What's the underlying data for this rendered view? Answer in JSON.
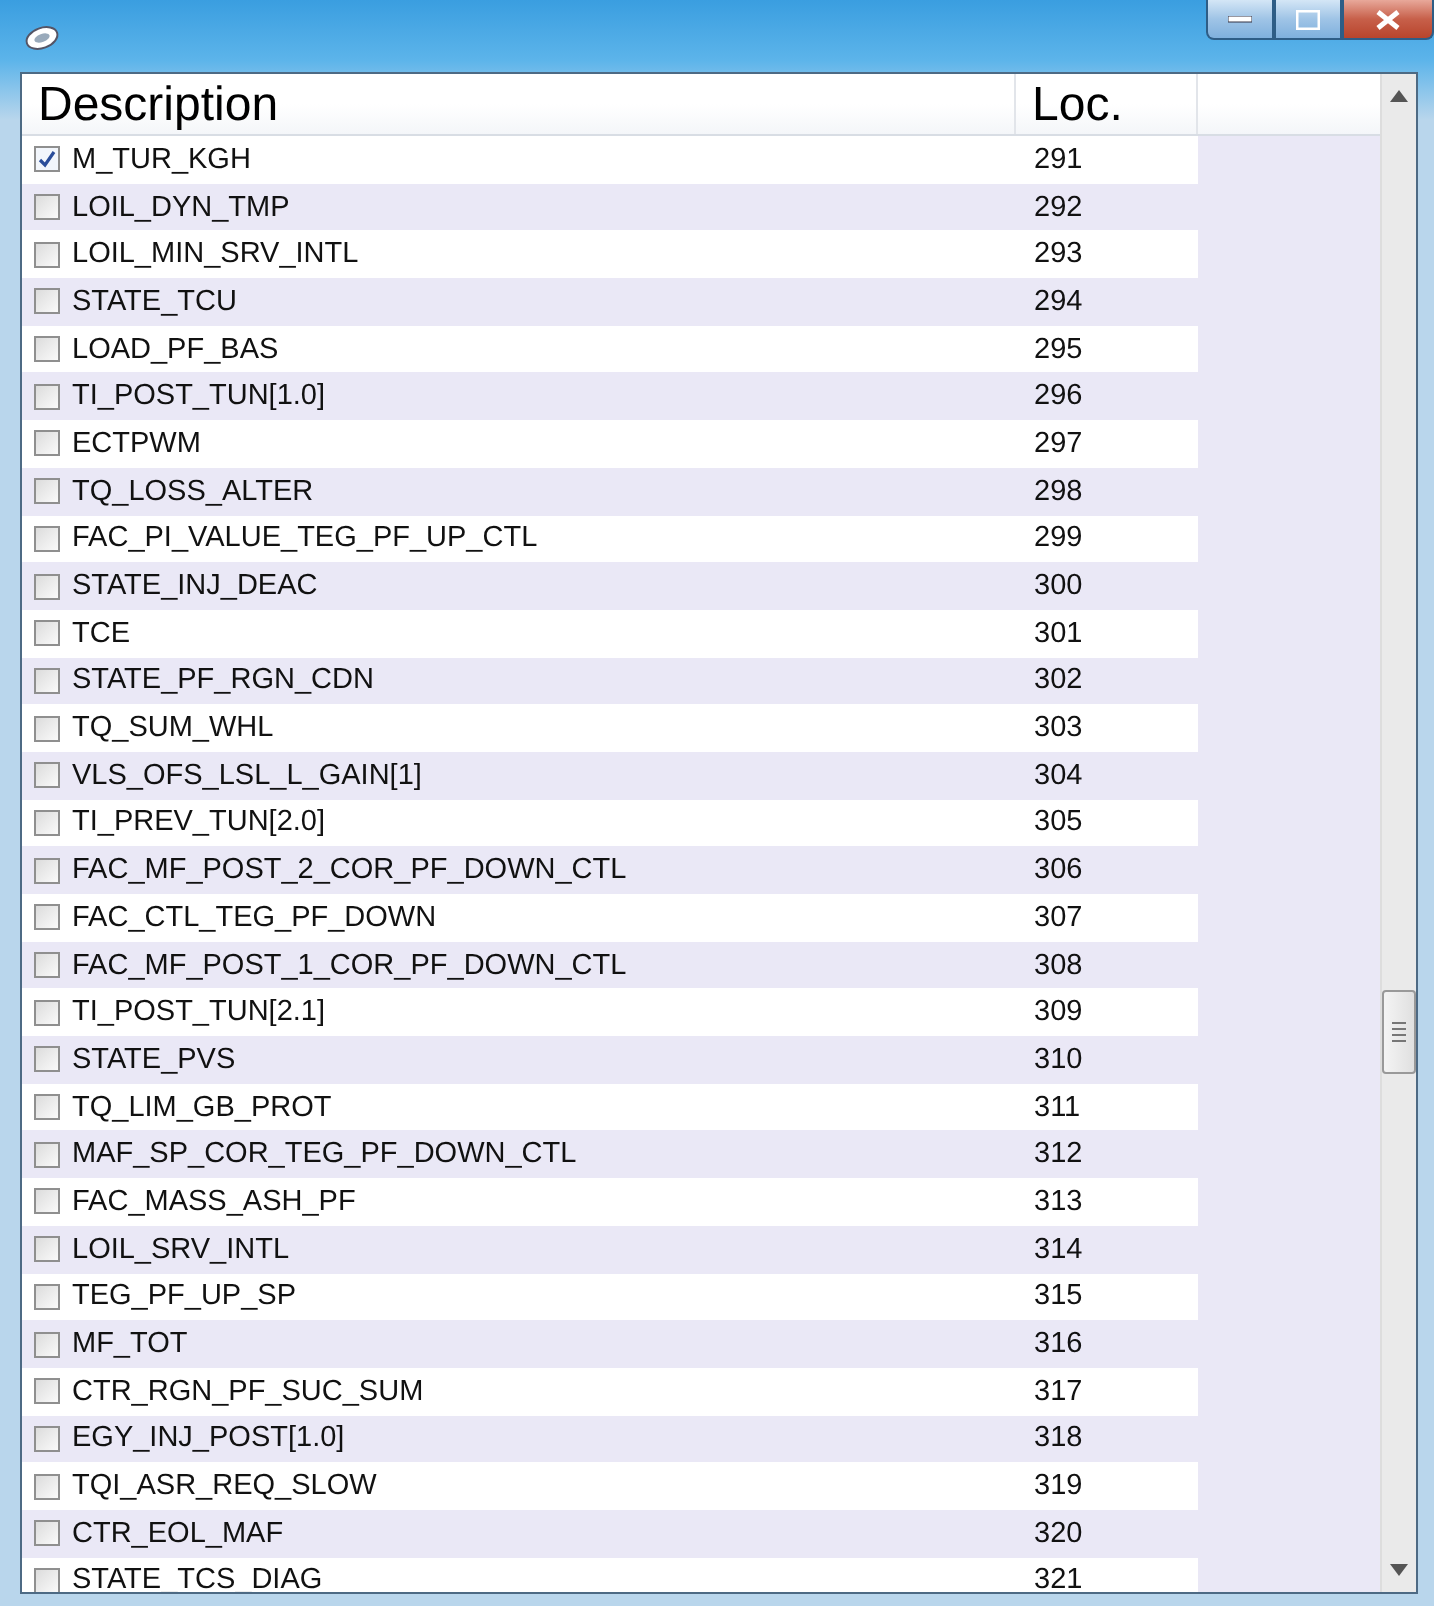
{
  "window": {
    "buttons": [
      {
        "kind": "minimize"
      },
      {
        "kind": "maximize"
      },
      {
        "kind": "close"
      }
    ]
  },
  "table": {
    "columns": [
      "Description",
      "Loc."
    ],
    "rows": [
      {
        "description": "M_TUR_KGH",
        "loc": "291",
        "checked": true
      },
      {
        "description": "LOIL_DYN_TMP",
        "loc": "292",
        "checked": false
      },
      {
        "description": "LOIL_MIN_SRV_INTL",
        "loc": "293",
        "checked": false
      },
      {
        "description": "STATE_TCU",
        "loc": "294",
        "checked": false
      },
      {
        "description": "LOAD_PF_BAS",
        "loc": "295",
        "checked": false
      },
      {
        "description": "TI_POST_TUN[1.0]",
        "loc": "296",
        "checked": false
      },
      {
        "description": "ECTPWM",
        "loc": "297",
        "checked": false
      },
      {
        "description": "TQ_LOSS_ALTER",
        "loc": "298",
        "checked": false
      },
      {
        "description": "FAC_PI_VALUE_TEG_PF_UP_CTL",
        "loc": "299",
        "checked": false
      },
      {
        "description": "STATE_INJ_DEAC",
        "loc": "300",
        "checked": false
      },
      {
        "description": "TCE",
        "loc": "301",
        "checked": false
      },
      {
        "description": "STATE_PF_RGN_CDN",
        "loc": "302",
        "checked": false
      },
      {
        "description": "TQ_SUM_WHL",
        "loc": "303",
        "checked": false
      },
      {
        "description": "VLS_OFS_LSL_L_GAIN[1]",
        "loc": "304",
        "checked": false
      },
      {
        "description": "TI_PREV_TUN[2.0]",
        "loc": "305",
        "checked": false
      },
      {
        "description": "FAC_MF_POST_2_COR_PF_DOWN_CTL",
        "loc": "306",
        "checked": false
      },
      {
        "description": "FAC_CTL_TEG_PF_DOWN",
        "loc": "307",
        "checked": false
      },
      {
        "description": "FAC_MF_POST_1_COR_PF_DOWN_CTL",
        "loc": "308",
        "checked": false
      },
      {
        "description": "TI_POST_TUN[2.1]",
        "loc": "309",
        "checked": false
      },
      {
        "description": "STATE_PVS",
        "loc": "310",
        "checked": false
      },
      {
        "description": "TQ_LIM_GB_PROT",
        "loc": "311",
        "checked": false
      },
      {
        "description": "MAF_SP_COR_TEG_PF_DOWN_CTL",
        "loc": "312",
        "checked": false
      },
      {
        "description": "FAC_MASS_ASH_PF",
        "loc": "313",
        "checked": false
      },
      {
        "description": "LOIL_SRV_INTL",
        "loc": "314",
        "checked": false
      },
      {
        "description": "TEG_PF_UP_SP",
        "loc": "315",
        "checked": false
      },
      {
        "description": "MF_TOT",
        "loc": "316",
        "checked": false
      },
      {
        "description": "CTR_RGN_PF_SUC_SUM",
        "loc": "317",
        "checked": false
      },
      {
        "description": "EGY_INJ_POST[1.0]",
        "loc": "318",
        "checked": false
      },
      {
        "description": "TQI_ASR_REQ_SLOW",
        "loc": "319",
        "checked": false
      },
      {
        "description": "CTR_EOL_MAF",
        "loc": "320",
        "checked": false
      },
      {
        "description": "STATE_TCS_DIAG",
        "loc": "321",
        "checked": false
      }
    ]
  }
}
